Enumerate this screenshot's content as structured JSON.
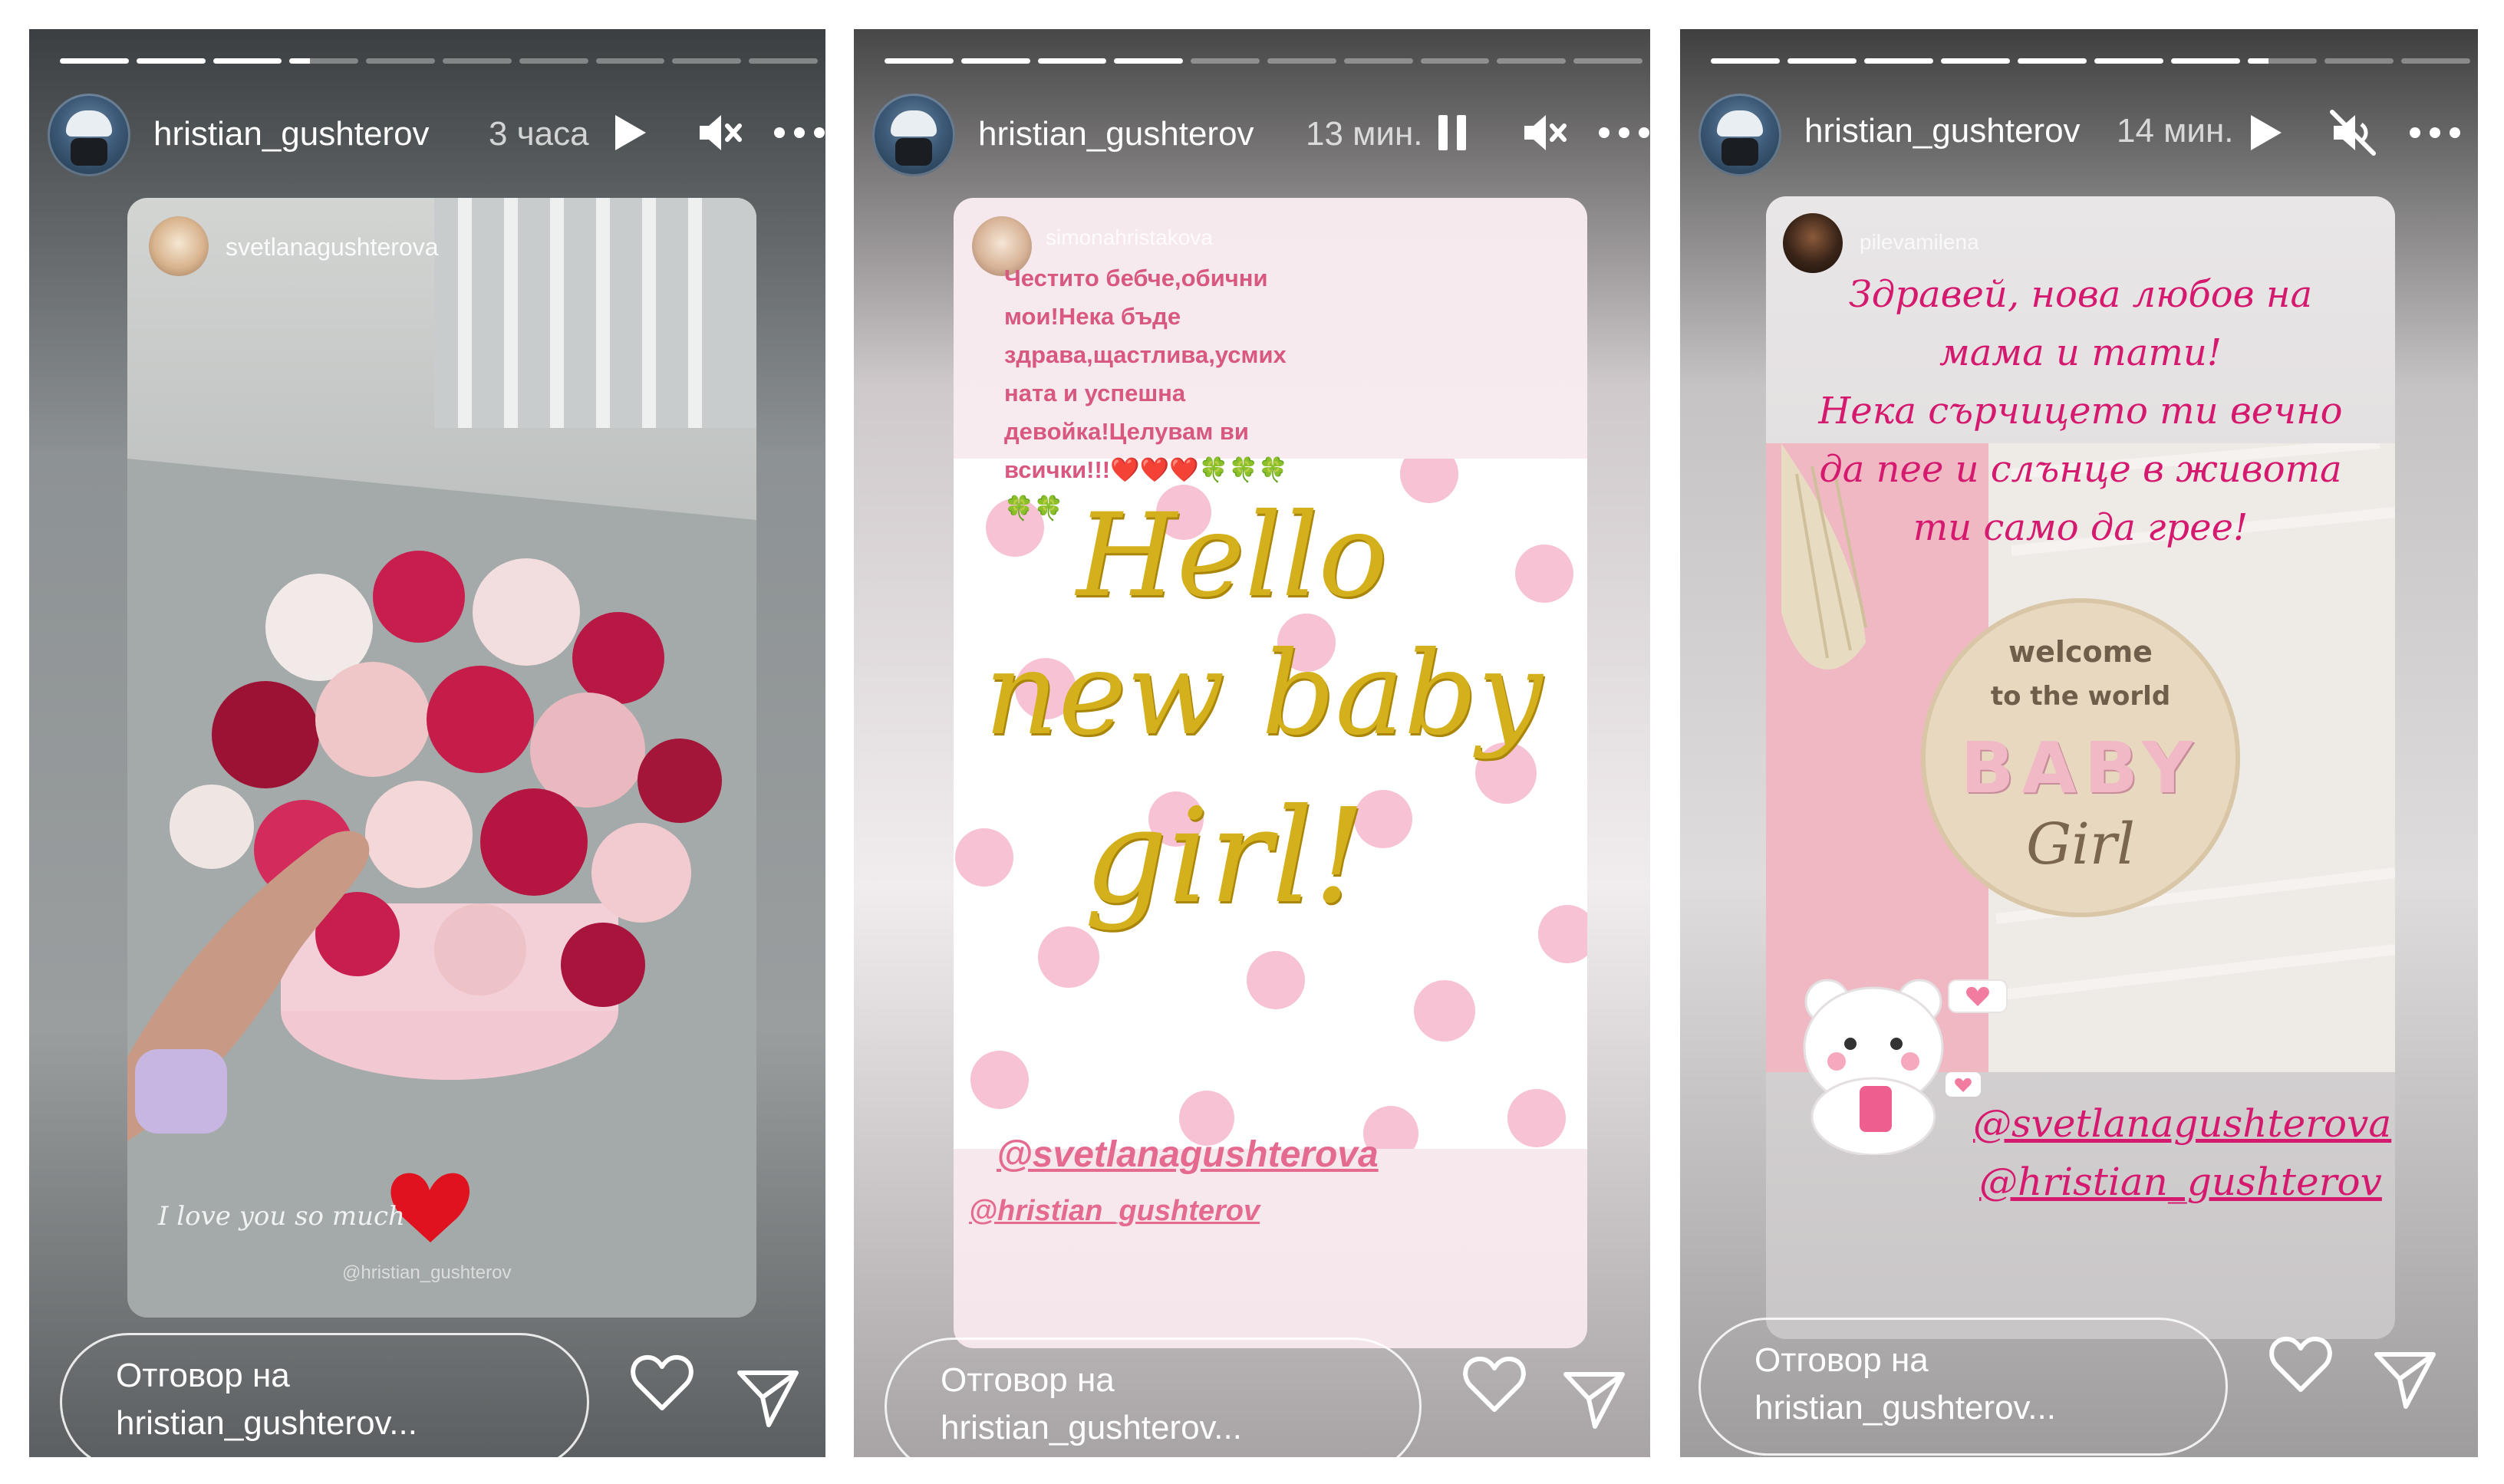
{
  "stories": [
    {
      "username": "hristian_gushterov",
      "time": "3 часа",
      "reply_line1": "Отговор на",
      "reply_line2": "hristian_gushterov...",
      "mention_user": "svetlanagushterova",
      "caption": "I love you so much",
      "caption_tag": "@hristian_gushterov",
      "progress": [
        1,
        1,
        1,
        0.3,
        0,
        0,
        0,
        0,
        0,
        0
      ]
    },
    {
      "username": "hristian_gushterov",
      "time": "13 мин.",
      "reply_line1": "Отговор на",
      "reply_line2": "hristian_gushterov...",
      "mention_user": "simonahristakova",
      "message_lines": [
        "Честито бебче,обични",
        "мои!Нека бъде",
        "здрава,щастлива,усмих",
        "ната и успешна",
        "девойка!Целувам ви",
        "всички!!!❤️❤️❤️🍀🍀🍀",
        "🍀🍀"
      ],
      "art_lines": [
        "Hello",
        "new baby",
        "girl!"
      ],
      "tag1": "@svetlanagushterova",
      "tag2": "@hristian_gushterov",
      "progress": [
        1,
        1,
        1,
        1,
        0,
        0,
        0,
        0,
        0,
        0
      ]
    },
    {
      "username": "hristian_gushterov",
      "time": "14 мин.",
      "reply_line1": "Отговор на",
      "reply_line2": "hristian_gushterov...",
      "mention_user": "pilevamilena",
      "message_lines": [
        "Здравей, нова любов на",
        "мама и тати!",
        "Нека сърчицето ти вечно",
        "да пее и слънце в живота",
        "ти само да грее!"
      ],
      "plaque_line1": "welcome",
      "plaque_line2": "to the world",
      "plaque_line3": "BABY",
      "plaque_line4": "Girl",
      "tag1": "@svetlanagushterova",
      "tag2": "@hristian_gushterov",
      "progress": [
        1,
        1,
        1,
        1,
        1,
        1,
        1,
        0.3,
        0,
        0
      ]
    }
  ]
}
